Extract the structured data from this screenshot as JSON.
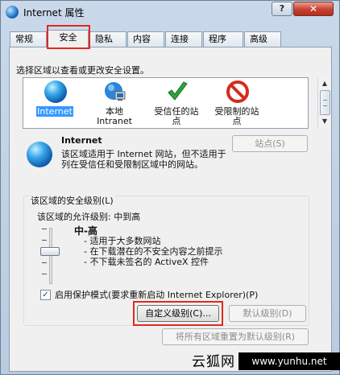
{
  "window": {
    "title": "Internet 属性",
    "help_label": "?",
    "close_label": "✕"
  },
  "tabs": [
    {
      "label": "常规"
    },
    {
      "label": "安全"
    },
    {
      "label": "隐私"
    },
    {
      "label": "内容"
    },
    {
      "label": "连接"
    },
    {
      "label": "程序"
    },
    {
      "label": "高级"
    }
  ],
  "active_tab": "安全",
  "security": {
    "instruction": "选择区域以查看或更改安全设置。",
    "zones": [
      {
        "label": "Internet",
        "icon": "globe-icon",
        "selected": true
      },
      {
        "label": "本地\nIntranet",
        "icon": "intranet-icon",
        "selected": false
      },
      {
        "label": "受信任的站\n点",
        "icon": "checkmark-icon",
        "selected": false
      },
      {
        "label": "受限制的站\n点",
        "icon": "no-entry-icon",
        "selected": false
      }
    ],
    "info_title": "Internet",
    "info_description": "该区域适用于 Internet 网站，但不适用于列在受信任和受限制区域中的网站。",
    "sites_button": "站点(S)",
    "group_title": "该区域的安全级别(L)",
    "allowed_levels": "该区域的允许级别: 中到高",
    "level_name": "中-高",
    "level_bullets": [
      "- 适用于大多数网站",
      "- 在下载潜在的不安全内容之前提示",
      "- 不下载未签名的 ActiveX 控件"
    ],
    "protected_mode_label": "启用保护模式(要求重新启动 Internet Explorer)(P)",
    "protected_mode_checked": true,
    "custom_level_button": "自定义级别(C)...",
    "default_level_button": "默认级别(D)",
    "reset_all_button": "将所有区域重置为默认级别(R)"
  },
  "watermark": {
    "site_name": "云狐网",
    "url": "www.yunhu.net"
  },
  "colors": {
    "highlight": "#e0291d",
    "selection": "#3399ff"
  }
}
